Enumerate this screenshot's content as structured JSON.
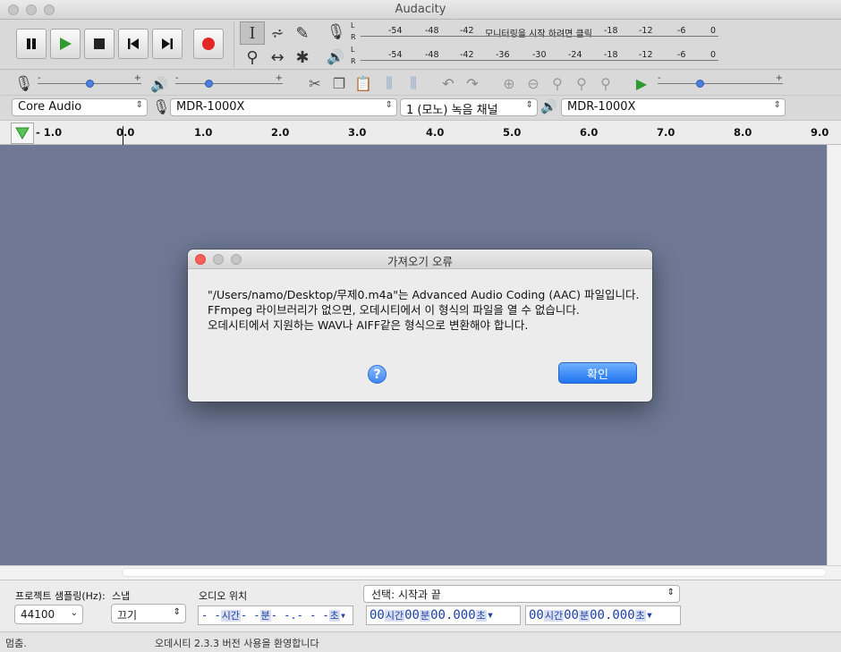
{
  "window": {
    "title": "Audacity"
  },
  "meters": {
    "record_scale": [
      "-54",
      "-48",
      "-42",
      "-18",
      "-12",
      "-6",
      "0"
    ],
    "record_prompt": "모니터링을 시작 하려면 클릭",
    "play_scale": [
      "-54",
      "-48",
      "-42",
      "-36",
      "-30",
      "-24",
      "-18",
      "-12",
      "-6",
      "0"
    ],
    "channel_left": "L",
    "channel_right": "R"
  },
  "mixer": {
    "min": "-",
    "max": "+",
    "record_level": 0.5,
    "play_level": 0.3,
    "speed_level": 0.33
  },
  "device": {
    "host": "Core Audio",
    "recording_device": "MDR-1000X",
    "channels": "1 (모노) 녹음 채널",
    "playback_device": "MDR-1000X"
  },
  "ruler": {
    "ticks": [
      "- 1.0",
      "0.0",
      "1.0",
      "2.0",
      "3.0",
      "4.0",
      "5.0",
      "6.0",
      "7.0",
      "8.0",
      "9.0"
    ]
  },
  "dialog": {
    "title": "가져오기 오류",
    "line1": "\"/Users/namo/Desktop/무제0.m4a\"는 Advanced Audio Coding (AAC) 파일입니다.",
    "line2": "FFmpeg 라이브러리가 없으면, 오데시티에서 이 형식의 파일을 열 수 없습니다.",
    "line3": "오데시티에서 지원하는 WAV나 AIFF같은 형식으로 변환해야 합니다.",
    "help_label": "?",
    "ok_label": "확인"
  },
  "bottom": {
    "rate_label": "프로젝트 샘플링(Hz):",
    "rate_value": "44100",
    "snap_label": "스냅",
    "snap_value": "끄기",
    "audio_pos_label": "오디오 위치",
    "audio_pos": {
      "h": "- -",
      "h_unit": "시간",
      "m": "- -",
      "m_unit": "분",
      "s": "- -.- - -",
      "s_unit": "초"
    },
    "selection_mode": "선택: 시작과 끝",
    "sel_start": {
      "h": "00",
      "h_unit": "시간",
      "m": "00",
      "m_unit": "분",
      "s": "00.000",
      "s_unit": "초"
    },
    "sel_end": {
      "h": "00",
      "h_unit": "시간",
      "m": "00",
      "m_unit": "분",
      "s": "00.000",
      "s_unit": "초"
    }
  },
  "status": {
    "state": "멈춤.",
    "message": "오데시티 2.3.3 버전 사용을 환영합니다"
  }
}
